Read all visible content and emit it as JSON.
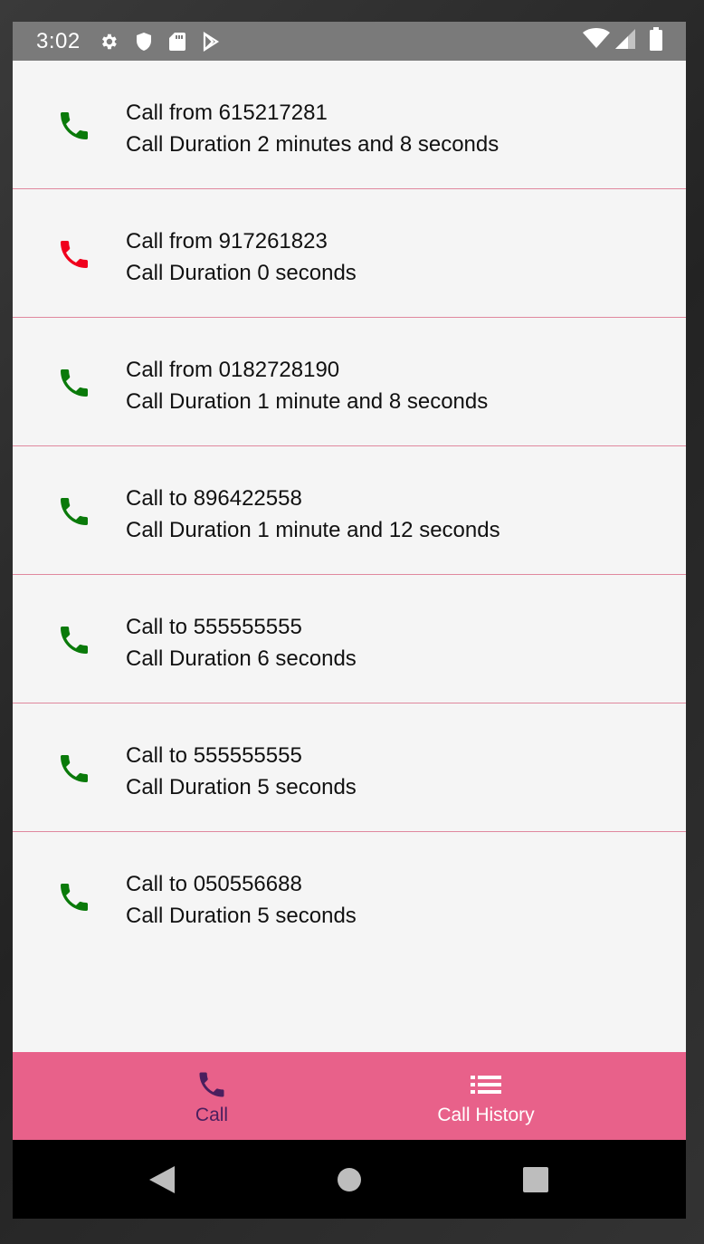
{
  "status_bar": {
    "time": "3:02",
    "icons": [
      "gear-icon",
      "shield-icon",
      "sd-card-icon",
      "play-store-icon",
      "wifi-icon",
      "signal-icon",
      "battery-icon"
    ]
  },
  "calls": [
    {
      "title": "Call from 615217281",
      "duration": "Call Duration 2 minutes and 8 seconds",
      "status": "completed"
    },
    {
      "title": "Call from 917261823",
      "duration": "Call Duration 0 seconds",
      "status": "missed"
    },
    {
      "title": "Call from 0182728190",
      "duration": "Call Duration 1 minute and 8 seconds",
      "status": "completed"
    },
    {
      "title": "Call to 896422558",
      "duration": "Call Duration 1 minute and 12 seconds",
      "status": "completed"
    },
    {
      "title": "Call to 555555555",
      "duration": "Call Duration 6 seconds",
      "status": "completed"
    },
    {
      "title": "Call to 555555555",
      "duration": "Call Duration 5 seconds",
      "status": "completed"
    },
    {
      "title": "Call to 050556688",
      "duration": "Call Duration 5 seconds",
      "status": "completed"
    }
  ],
  "bottom_nav": {
    "call_label": "Call",
    "history_label": "Call History",
    "active": "call"
  },
  "colors": {
    "completed": "#0a7a0a",
    "missed": "#f0001c",
    "nav_background": "#e8618a",
    "nav_active": "#4a1f5e",
    "divider": "#e0889e"
  }
}
